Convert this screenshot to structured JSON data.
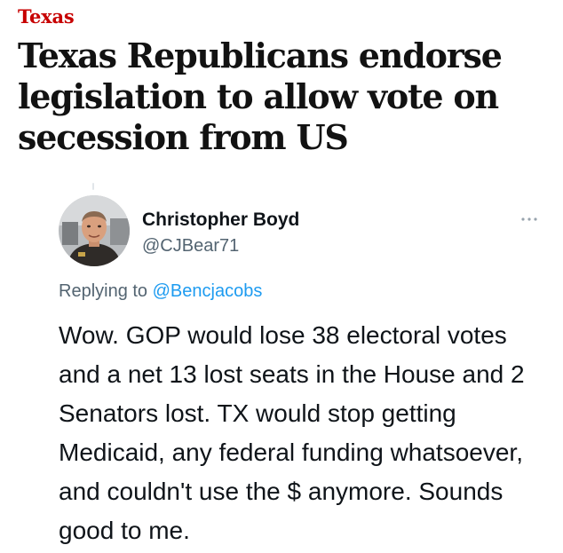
{
  "article": {
    "kicker": "Texas",
    "headline": "Texas Republicans endorse legislation to allow vote on secession from US"
  },
  "tweet": {
    "display_name": "Christopher Boyd",
    "handle": "@CJBear71",
    "reply_prefix": "Replying to",
    "reply_handle": "@Bencjacobs",
    "body": "Wow. GOP would lose 38 electoral votes and a net 13 lost seats in the House and 2 Senators lost. TX would stop getting Medicaid, any federal funding whatsoever, and couldn't use the $ anymore. Sounds good to me.",
    "icons": {
      "avatar": "profile-photo",
      "more": "more-horizontal-icon"
    }
  },
  "colors": {
    "kicker": "#c70000",
    "headline": "#121212",
    "link": "#1d9bf0",
    "secondary_text": "#536471",
    "primary_text": "#0f1419"
  }
}
